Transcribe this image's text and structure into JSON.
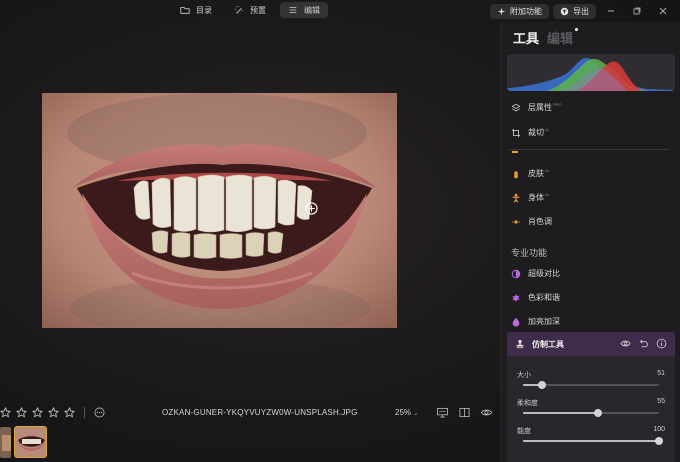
{
  "topnav": {
    "items": [
      {
        "label": "目录",
        "icon": "folder-icon"
      },
      {
        "label": "预置",
        "icon": "wand-icon"
      },
      {
        "label": "编辑",
        "icon": "sliders-icon",
        "active": true
      }
    ]
  },
  "topright": {
    "addons_label": "附加功能",
    "export_label": "导出"
  },
  "bottom": {
    "rating_stars": 5,
    "rating_value": 0,
    "filename": "OZKAN-GUNER-YKQYVUYZW0W-UNSPLASH.JPG",
    "zoom": "25%"
  },
  "panel": {
    "tab_tools": "工具",
    "tab_edit": "编辑",
    "items": [
      {
        "label": "层属性",
        "badge": "PRO",
        "icon": "layers-icon"
      },
      {
        "label": "裁切",
        "badge": "AI",
        "icon": "crop-icon"
      },
      {
        "label": "皮肤",
        "badge": "AI",
        "icon": "skin-icon",
        "color": "#f0a030"
      },
      {
        "label": "身体",
        "badge": "AI",
        "icon": "body-icon",
        "color": "#f0a030"
      },
      {
        "label": "肖色调",
        "badge": "",
        "icon": "portrait-tone-icon",
        "color": "#f0a030"
      }
    ],
    "pro_section_title": "专业功能",
    "pro_items": [
      {
        "label": "超级对比",
        "icon": "contrast-icon",
        "color": "#b76ce0"
      },
      {
        "label": "色彩和谐",
        "icon": "harmony-icon",
        "color": "#b76ce0"
      },
      {
        "label": "加亮加深",
        "icon": "dodge-burn-icon",
        "color": "#b76ce0"
      }
    ],
    "active_tool": {
      "label": "仿制工具",
      "icon": "clone-stamp-icon",
      "sliders": [
        {
          "label": "大小",
          "value": 51,
          "fraction": 0.14
        },
        {
          "label": "柔和度",
          "value": 55,
          "fraction": 0.55
        },
        {
          "label": "能度",
          "value": 100,
          "fraction": 1.0
        }
      ]
    }
  },
  "colors": {
    "accent_purple": "#b76ce0",
    "accent_orange": "#f0a030",
    "active_tool_bg": "#3f2c4a",
    "thumb_border": "#d7a83a"
  }
}
